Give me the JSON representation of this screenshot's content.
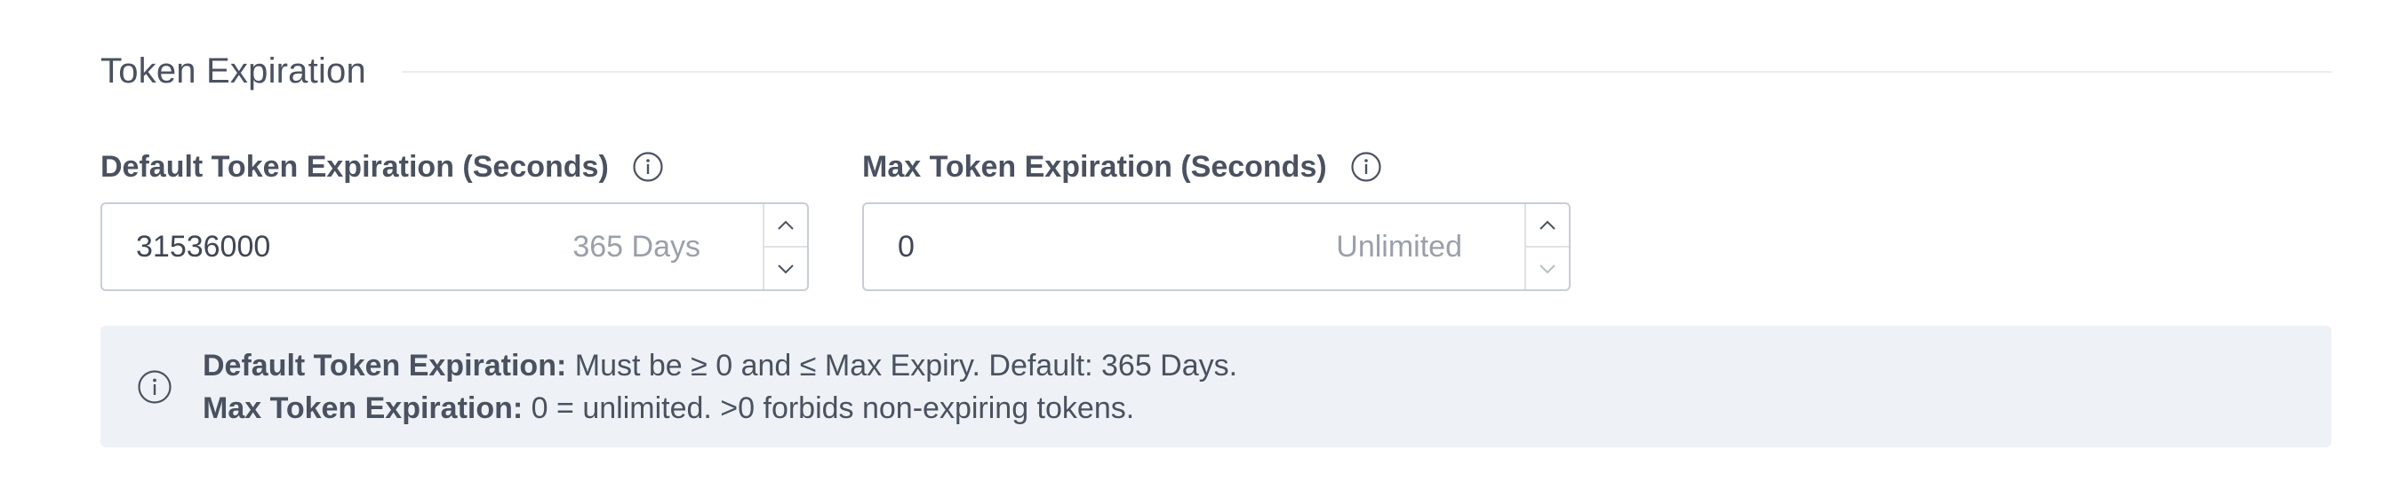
{
  "section": {
    "title": "Token Expiration"
  },
  "default_field": {
    "label": "Default Token Expiration (Seconds)",
    "value": "31536000",
    "hint": "365 Days"
  },
  "max_field": {
    "label": "Max Token Expiration (Seconds)",
    "value": "0",
    "hint": "Unlimited"
  },
  "info_banner": {
    "line1_label": "Default Token Expiration:",
    "line1_text": " Must be ≥ 0 and ≤ Max Expiry. Default: 365 Days.",
    "line2_label": "Max Token Expiration:",
    "line2_text": " 0 = unlimited. >0 forbids non-expiring tokens."
  },
  "icons": {
    "info": "info-circle-icon",
    "stepper_up": "chevron-up-icon",
    "stepper_down": "chevron-down-icon"
  },
  "colors": {
    "text": "#4a5160",
    "hint": "#9aa0aa",
    "border": "#c9cdd6",
    "banner_bg": "#eef2f6"
  }
}
